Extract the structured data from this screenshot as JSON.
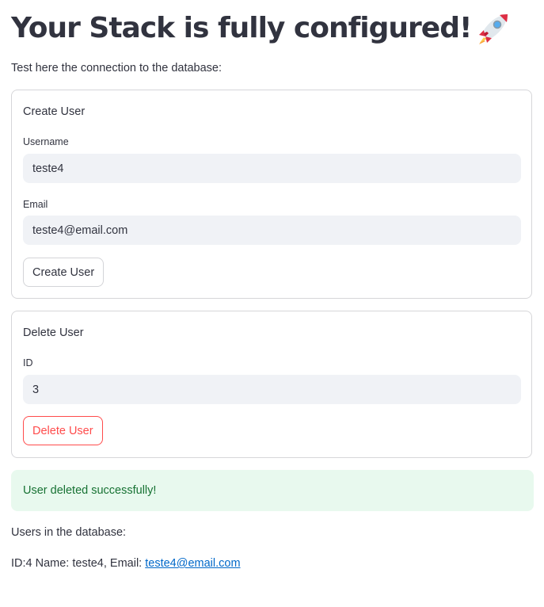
{
  "header": {
    "title": "Your Stack is fully configured!",
    "title_icon": "rocket-icon"
  },
  "subtitle": "Test here the connection to the database:",
  "create_user": {
    "heading": "Create User",
    "username_label": "Username",
    "username_value": "teste4",
    "email_label": "Email",
    "email_value": "teste4@email.com",
    "button_label": "Create User"
  },
  "delete_user": {
    "heading": "Delete User",
    "id_label": "ID",
    "id_value": "3",
    "button_label": "Delete User"
  },
  "alert": {
    "message": "User deleted successfully!",
    "status": "success",
    "background_color": "#e8f9ee",
    "text_color": "#177233"
  },
  "users": {
    "heading": "Users in the database:",
    "items": [
      {
        "prefix": "ID:4 Name: teste4, Email: ",
        "email": "teste4@email.com"
      }
    ]
  },
  "colors": {
    "text": "#31333f",
    "input_bg": "#f0f2f6",
    "danger": "#ff4b4b",
    "link": "#0068c9"
  }
}
